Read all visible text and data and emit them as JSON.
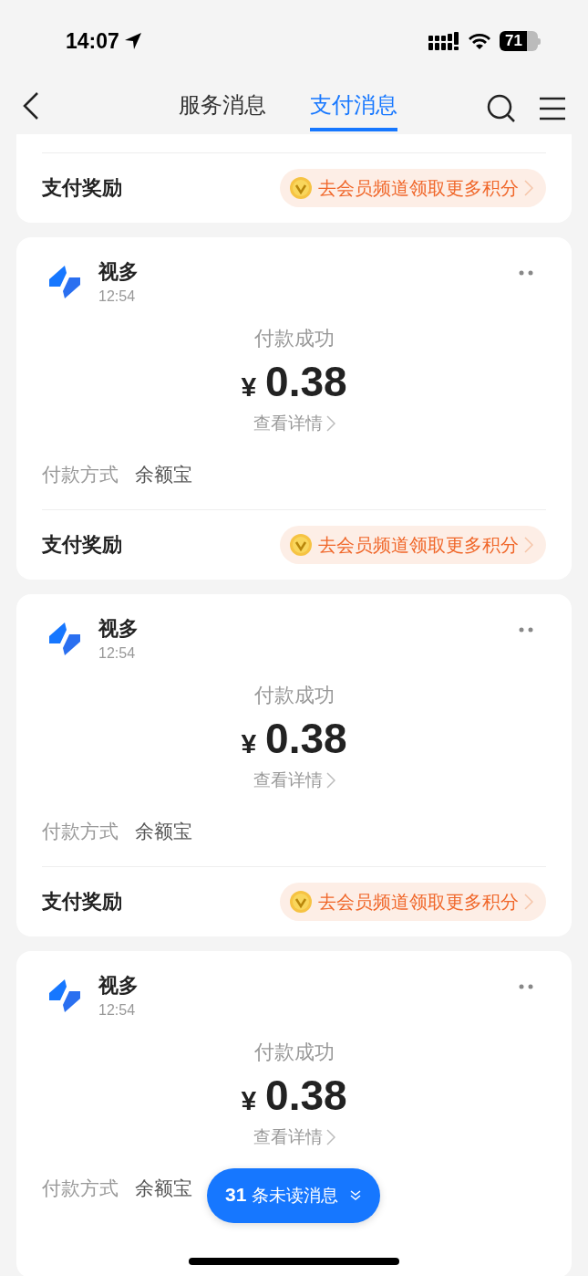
{
  "status_bar": {
    "time": "14:07",
    "battery": "71"
  },
  "header": {
    "tabs": [
      {
        "label": "服务消息",
        "selected": false
      },
      {
        "label": "支付消息",
        "selected": true
      }
    ]
  },
  "messages": [
    {
      "kind": "partial",
      "reward_label": "支付奖励",
      "reward_link": "去会员频道领取更多积分"
    },
    {
      "kind": "full",
      "sender": "视多",
      "time": "12:54",
      "status": "付款成功",
      "currency": "¥",
      "amount": "0.38",
      "details": "查看详情",
      "method_label": "付款方式",
      "method_value": "余额宝",
      "reward_label": "支付奖励",
      "reward_link": "去会员频道领取更多积分"
    },
    {
      "kind": "full",
      "sender": "视多",
      "time": "12:54",
      "status": "付款成功",
      "currency": "¥",
      "amount": "0.38",
      "details": "查看详情",
      "method_label": "付款方式",
      "method_value": "余额宝",
      "reward_label": "支付奖励",
      "reward_link": "去会员频道领取更多积分"
    },
    {
      "kind": "full",
      "sender": "视多",
      "time": "12:54",
      "status": "付款成功",
      "currency": "¥",
      "amount": "0.38",
      "details": "查看详情",
      "method_label": "付款方式",
      "method_value": "余额宝"
    }
  ],
  "unread": {
    "count": "31",
    "label": "条未读消息"
  }
}
